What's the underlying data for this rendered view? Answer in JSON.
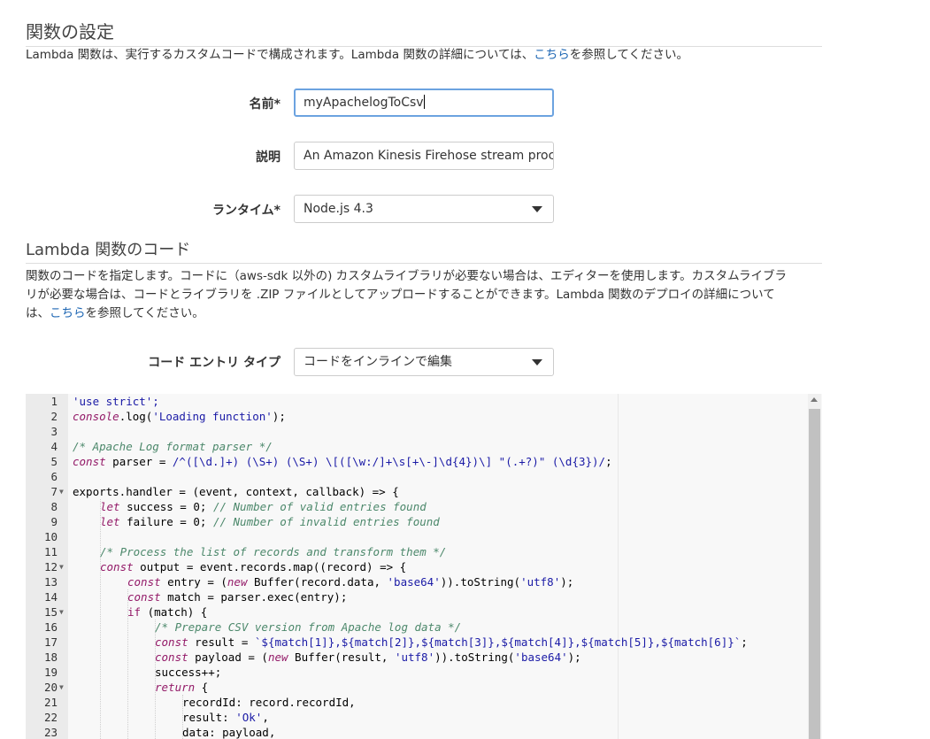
{
  "section1": {
    "title": "関数の設定",
    "desc_pre": "Lambda 関数は、実行するカスタムコードで構成されます。Lambda 関数の詳細については、",
    "desc_link": "こちら",
    "desc_post": "を参照してください。"
  },
  "form": {
    "name_label": "名前*",
    "name_value": "myApachelogToCsv",
    "desc_label": "説明",
    "desc_value": "An Amazon Kinesis Firehose stream proces",
    "runtime_label": "ランタイム*",
    "runtime_value": "Node.js 4.3"
  },
  "section2": {
    "title": "Lambda 関数のコード",
    "desc_line1": "関数のコードを指定します。コードに（aws-sdk 以外の) カスタムライブラリが必要ない場合は、エディターを使用します。カスタムライブラ",
    "desc_line2": "リが必要な場合は、コードとライブラリを .ZIP ファイルとしてアップロードすることができます。Lambda 関数のデプロイの詳細について",
    "desc_line3_pre": "は、",
    "desc_link": "こちら",
    "desc_line3_post": "を参照してください。",
    "entry_label": "コード エントリ タイプ",
    "entry_value": "コードをインラインで編集"
  },
  "editor": {
    "line_numbers": [
      "1",
      "2",
      "3",
      "4",
      "5",
      "6",
      "7",
      "8",
      "9",
      "10",
      "11",
      "12",
      "13",
      "14",
      "15",
      "16",
      "17",
      "18",
      "19",
      "20",
      "21",
      "22",
      "23"
    ],
    "lines": {
      "l1": "'use strict';",
      "l2_a": "console",
      "l2_b": ".log(",
      "l2_c": "'Loading function'",
      "l2_d": ");",
      "l4": "/* Apache Log format parser */",
      "l5_a": "const",
      "l5_b": " parser = ",
      "l5_c": "/^([\\d.]+) (\\S+) (\\S+) \\[([\\w:/]+\\s[+\\-]\\d{4})\\] \"(.+?)\" (\\d{3})/",
      "l5_d": ";",
      "l7": "exports.handler = (event, context, callback) => {",
      "l8_a": "let",
      "l8_b": " success = 0; ",
      "l8_c": "// Number of valid entries found",
      "l9_a": "let",
      "l9_b": " failure = 0; ",
      "l9_c": "// Number of invalid entries found",
      "l11": "/* Process the list of records and transform them */",
      "l12_a": "const",
      "l12_b": " output = event.records.map((record) => {",
      "l13_a": "const",
      "l13_b": " entry = (",
      "l13_c": "new",
      "l13_d": " Buffer(record.data, ",
      "l13_e": "'base64'",
      "l13_f": ")).toString(",
      "l13_g": "'utf8'",
      "l13_h": ");",
      "l14_a": "const",
      "l14_b": " match = parser.exec(entry);",
      "l15_a": "if",
      "l15_b": " (match) {",
      "l16": "/* Prepare CSV version from Apache log data */",
      "l17_a": "const",
      "l17_b": " result = ",
      "l17_c": "`${match[1]},${match[2]},${match[3]},${match[4]},${match[5]},${match[6]}`",
      "l17_d": ";",
      "l18_a": "const",
      "l18_b": " payload = (",
      "l18_c": "new",
      "l18_d": " Buffer(result, ",
      "l18_e": "'utf8'",
      "l18_f": ")).toString(",
      "l18_g": "'base64'",
      "l18_h": ");",
      "l19": "success++;",
      "l20_a": "return",
      "l20_b": " {",
      "l21": "recordId: record.recordId,",
      "l22_a": "result: ",
      "l22_b": "'Ok'",
      "l22_c": ",",
      "l23": "data: payload,"
    }
  },
  "colors": {
    "link": "#1d66b3",
    "focus_border": "#6ca3e0",
    "keyword": "#931a68",
    "comment": "#4c886b",
    "string": "#1a1aa6"
  }
}
